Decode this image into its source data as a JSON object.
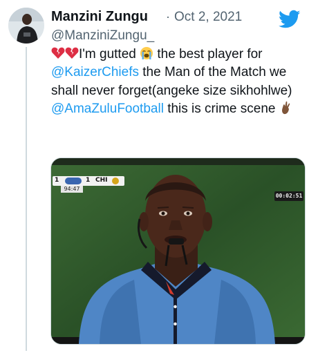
{
  "author": {
    "display_name": "Manzini Zungu",
    "handle": "@ManziniZungu_",
    "date": "Oct 2, 2021",
    "separator": "·"
  },
  "icons": {
    "broken_heart": "broken-heart-emoji",
    "crying_face": "loudly-crying-face-emoji",
    "crossed_fingers": "crossed-fingers-emoji",
    "brand": "twitter-bird-icon"
  },
  "colors": {
    "mention": "#1d9bf0",
    "brand": "#1d9bf0",
    "muted": "#536471"
  },
  "tweet": {
    "seg1": "I'm gutted",
    "seg2": " the best player for ",
    "mention1": "@KaizerChiefs",
    "seg3": " the Man of the Match we shall never forget(angeke size sikhohlwe) ",
    "mention2": "@AmaZuluFootball",
    "seg4": " this is crime scene "
  },
  "media": {
    "scorebug": {
      "home_score": "1",
      "away_score": "1",
      "away_team": "CHI",
      "clock": "94:47"
    },
    "replay_timer": "00:02:51"
  }
}
